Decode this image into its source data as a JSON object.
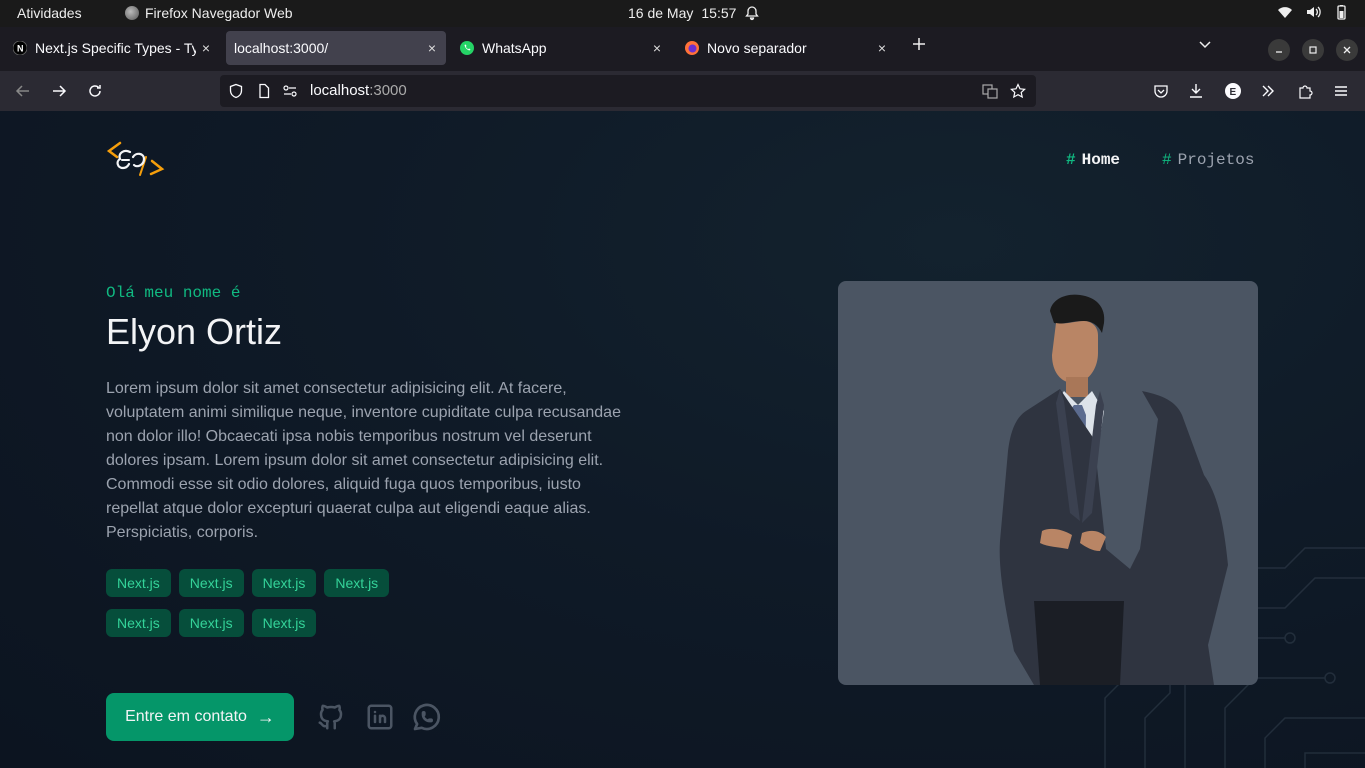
{
  "system": {
    "activities": "Atividades",
    "app_name": "Firefox Navegador Web",
    "date": "16 de May",
    "time": "15:57"
  },
  "tabs": [
    {
      "title": "Next.js Specific Types - Ty",
      "favicon": "nextjs-icon",
      "active": false
    },
    {
      "title": "localhost:3000/",
      "favicon": "none",
      "active": true
    },
    {
      "title": "WhatsApp",
      "favicon": "whatsapp-icon",
      "active": false
    },
    {
      "title": "Novo separador",
      "favicon": "firefox-icon",
      "active": false
    }
  ],
  "tab_close_glyph": "×",
  "address": {
    "host": "localhost",
    "port": ":3000"
  },
  "site": {
    "nav": [
      {
        "hash": "#",
        "label": "Home"
      },
      {
        "hash": "#",
        "label": "Projetos"
      }
    ],
    "greeting": "Olá meu nome é",
    "name": "Elyon Ortiz",
    "bio": "Lorem ipsum dolor sit amet consectetur adipisicing elit. At facere, voluptatem animi similique neque, inventore cupiditate culpa recusandae non dolor illo! Obcaecati ipsa nobis temporibus nostrum vel deserunt dolores ipsam. Lorem ipsum dolor sit amet consectetur adipisicing elit. Commodi esse sit odio dolores, aliquid fuga quos temporibus, iusto repellat atque dolor excepturi quaerat culpa aut eligendi eaque alias. Perspiciatis, corporis.",
    "tags": [
      "Next.js",
      "Next.js",
      "Next.js",
      "Next.js",
      "Next.js",
      "Next.js",
      "Next.js"
    ],
    "cta_label": "Entre em contato",
    "cta_arrow": "→",
    "social": [
      "github-icon",
      "linkedin-icon",
      "whatsapp-icon"
    ]
  },
  "colors": {
    "accent": "#10b981",
    "tag_bg": "#064e3b",
    "cta_bg": "#059669",
    "page_bg": "#0f1a27",
    "photo_bg": "#4b5563"
  }
}
